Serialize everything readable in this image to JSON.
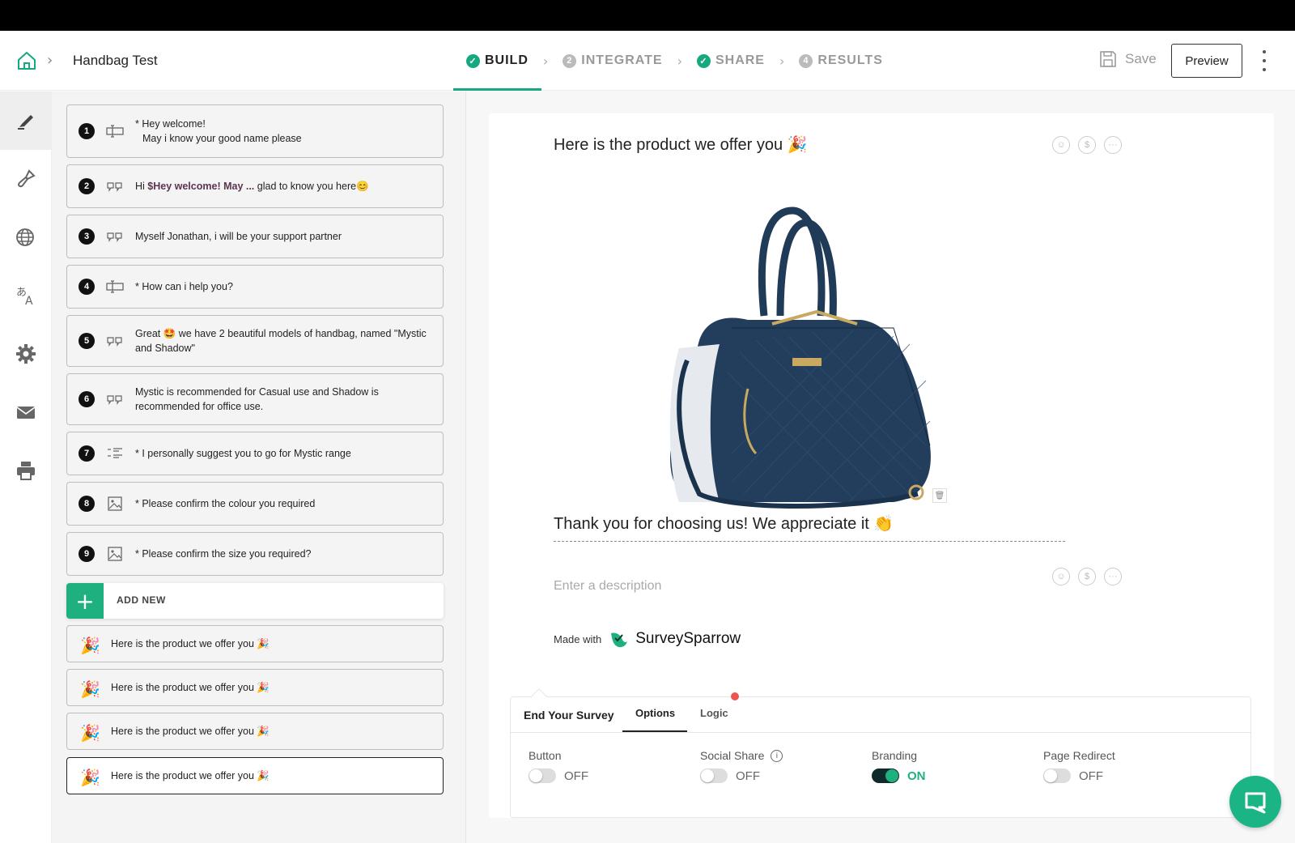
{
  "header": {
    "breadcrumb_title": "Handbag Test",
    "steps": [
      {
        "label": "BUILD",
        "state": "done",
        "num": ""
      },
      {
        "label": "INTEGRATE",
        "state": "todo",
        "num": "2"
      },
      {
        "label": "SHARE",
        "state": "done",
        "num": ""
      },
      {
        "label": "RESULTS",
        "state": "todo",
        "num": "4"
      }
    ],
    "save_label": "Save",
    "preview_label": "Preview"
  },
  "sidebar": {
    "items": [
      "edit-icon",
      "paint-brush-icon",
      "globe-icon",
      "translate-icon",
      "gear-icon",
      "mail-icon",
      "printer-icon"
    ]
  },
  "questions": [
    {
      "num": "1",
      "icon": "text-input-icon",
      "line1": "* Hey welcome!",
      "line2": "May i know your good name please"
    },
    {
      "num": "2",
      "icon": "quote-icon",
      "prefix": "Hi ",
      "bold": "$Hey welcome! May ...",
      "suffix": " glad to know you here😊"
    },
    {
      "num": "3",
      "icon": "quote-icon",
      "text": "Myself Jonathan, i will be your support partner"
    },
    {
      "num": "4",
      "icon": "text-input-icon",
      "text": "* How can i help you?"
    },
    {
      "num": "5",
      "icon": "quote-icon",
      "text": "Great 🤩 we have 2 beautiful models of handbag, named \"Mystic and Shadow\""
    },
    {
      "num": "6",
      "icon": "quote-icon",
      "text": "Mystic is recommended for Casual use and Shadow is recommended for office use."
    },
    {
      "num": "7",
      "icon": "choice-list-icon",
      "text": "* I personally suggest you to go for Mystic range"
    },
    {
      "num": "8",
      "icon": "image-icon",
      "text": "* Please confirm the colour you required"
    },
    {
      "num": "9",
      "icon": "image-icon",
      "text": "* Please confirm the size you required?"
    }
  ],
  "add_new_label": "ADD NEW",
  "end_screens": [
    {
      "icon": "🎉",
      "text": "Here is the product we offer you 🎉"
    },
    {
      "icon": "🎉",
      "text": "Here is the product we offer you 🎉"
    },
    {
      "icon": "🎉",
      "text": "Here is the product we offer you 🎉"
    },
    {
      "icon": "🎉",
      "text": "Here is the product we offer you 🎉"
    }
  ],
  "canvas": {
    "title": "Here is the product we offer you 🎉",
    "thanks": "Thank you for choosing us! We appreciate it 👏",
    "description_placeholder": "Enter a description",
    "made_with": "Made with",
    "brand_name": "SurveySparrow",
    "icon_trio": [
      "☺",
      "$",
      "···"
    ]
  },
  "end_panel": {
    "heading": "End Your Survey",
    "tabs": [
      "Options",
      "Logic"
    ],
    "active_tab": "Options",
    "options": [
      {
        "label": "Button",
        "state": "OFF",
        "on": false,
        "info": false
      },
      {
        "label": "Social Share",
        "state": "OFF",
        "on": false,
        "info": true
      },
      {
        "label": "Branding",
        "state": "ON",
        "on": true,
        "info": false
      },
      {
        "label": "Page Redirect",
        "state": "OFF",
        "on": false,
        "info": false
      }
    ]
  },
  "colors": {
    "accent": "#16a97f",
    "active_step_underline": "#16a97f",
    "notification_dot": "#ef5350"
  }
}
